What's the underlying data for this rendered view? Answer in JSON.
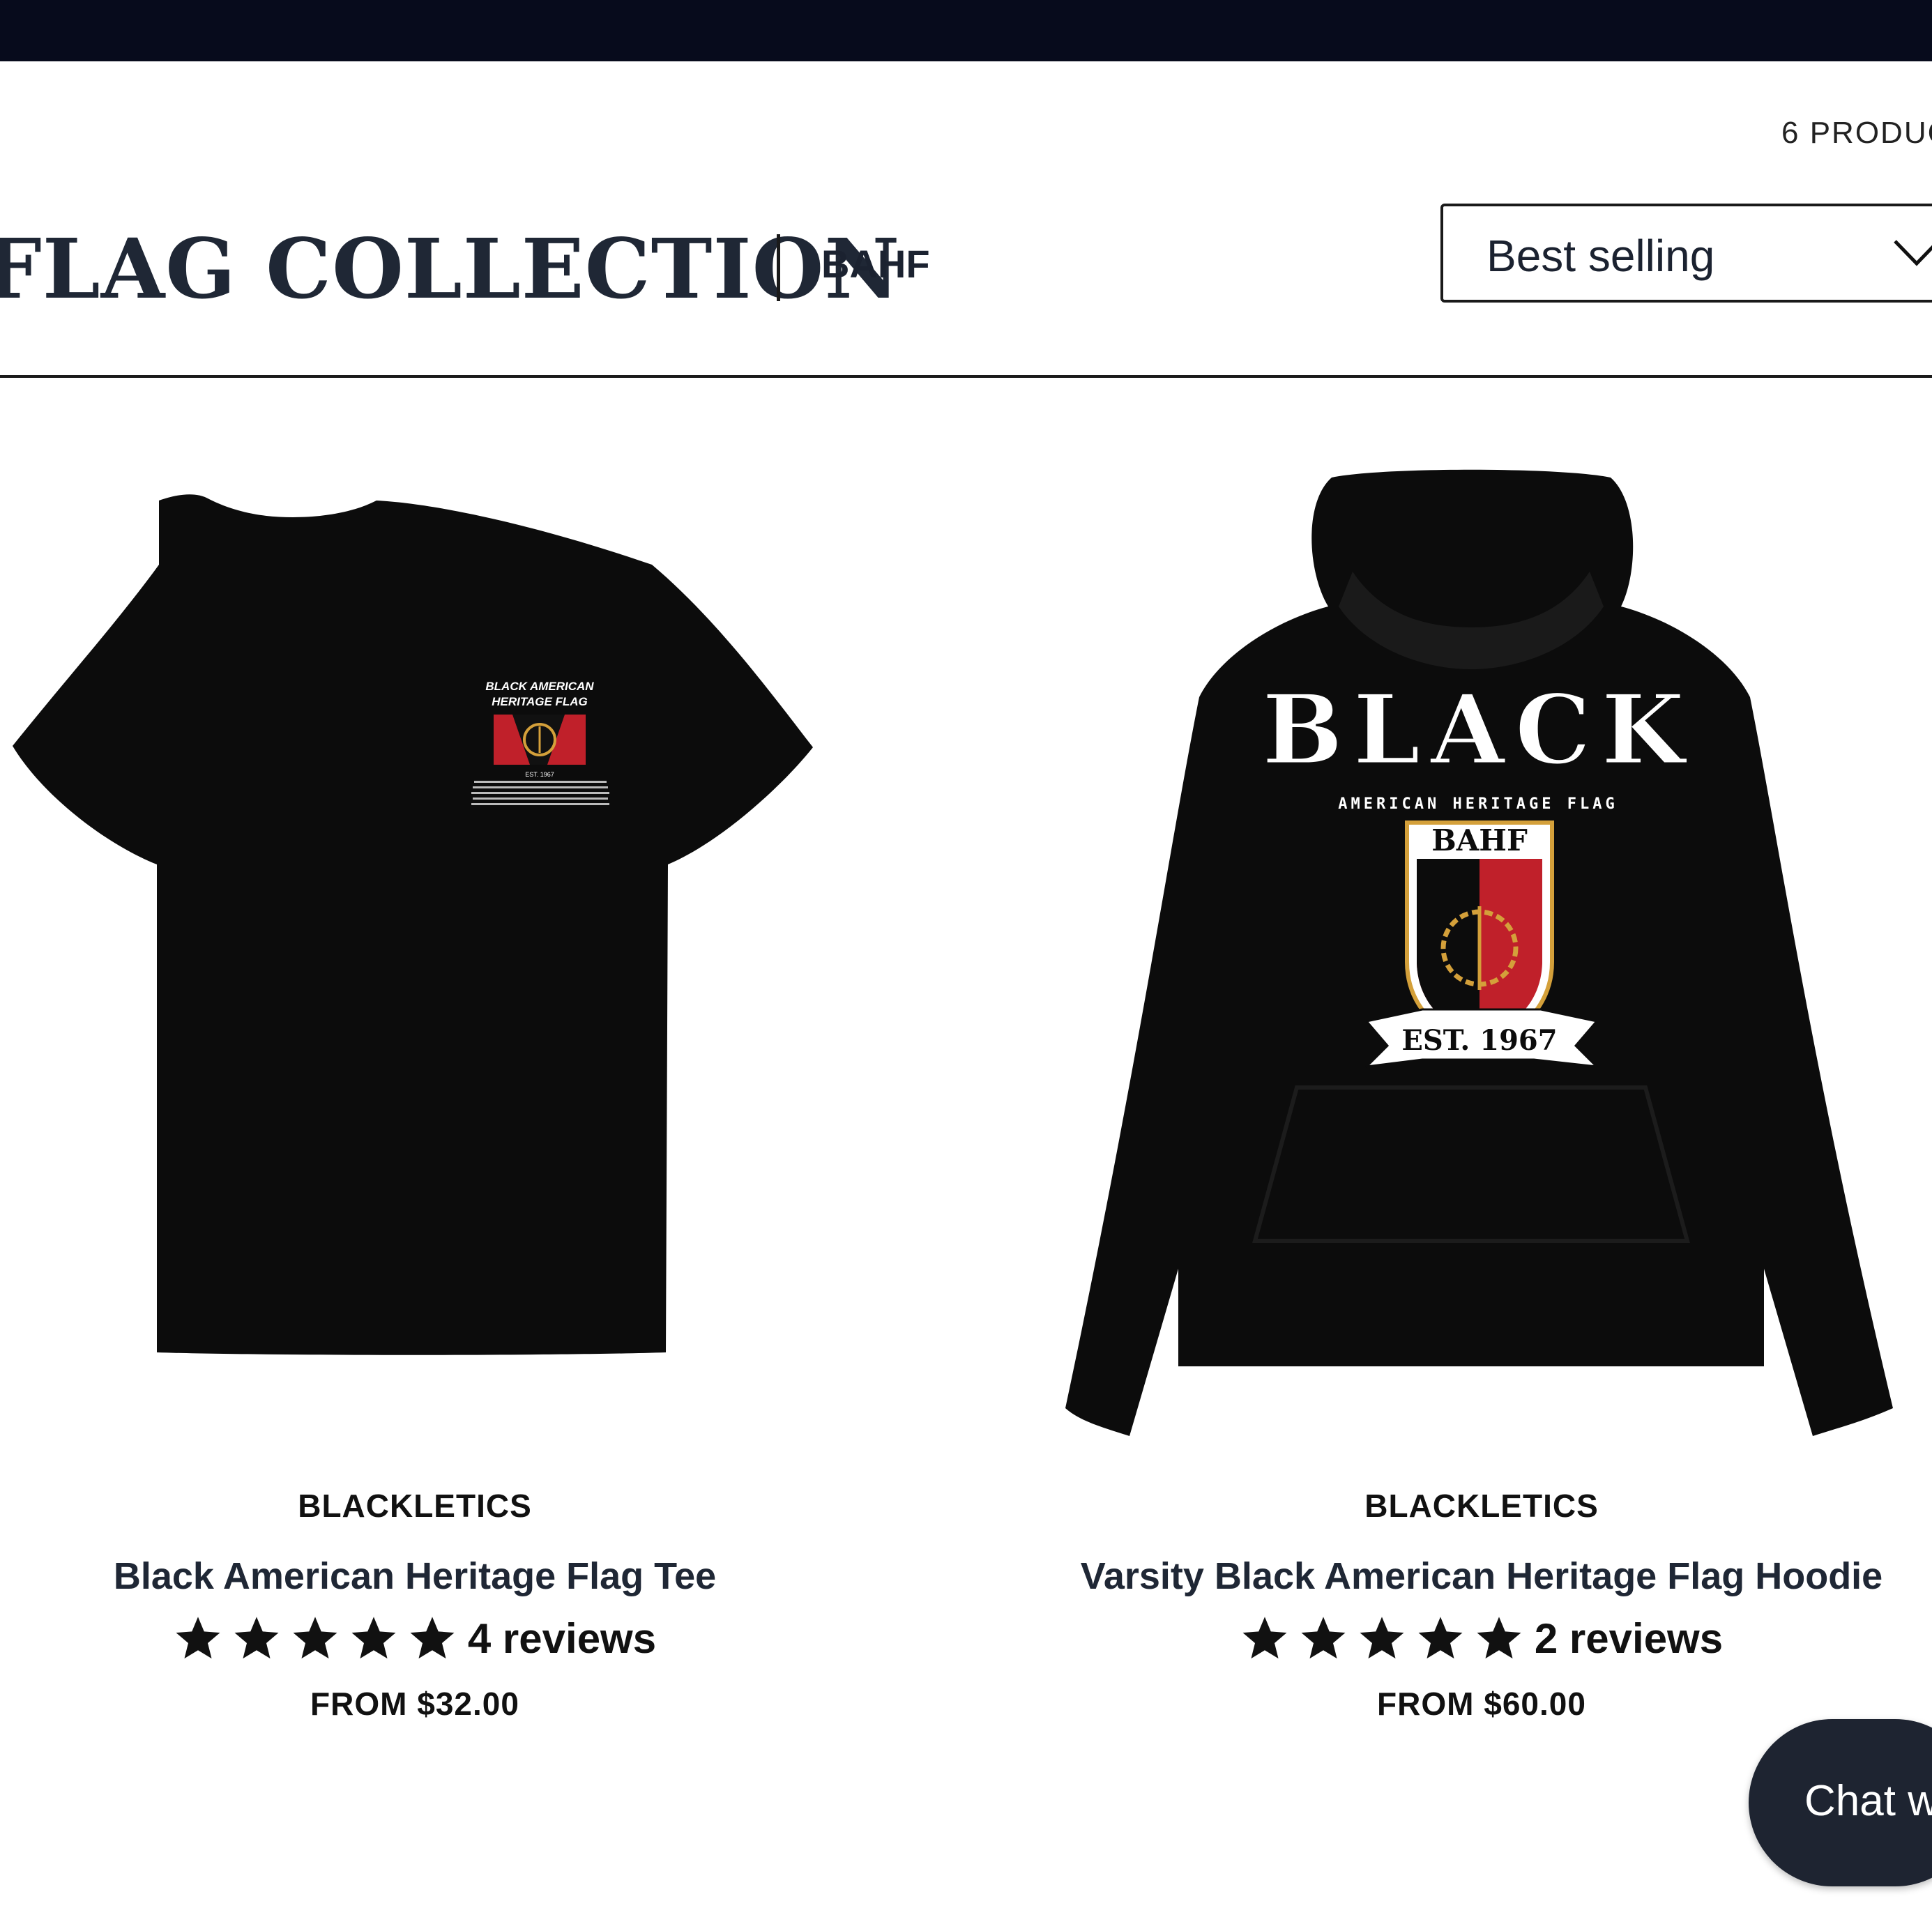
{
  "header": {
    "product_count": "6 PRODUC",
    "collection_title": "FLAG COLLECTION",
    "vendor_tag": "BAHF"
  },
  "sort": {
    "selected": "Best selling",
    "icon": "chevron-down-icon"
  },
  "products": [
    {
      "vendor": "BLACKLETICS",
      "title": "Black American Heritage Flag Tee",
      "rating": 5,
      "reviews": "4 reviews",
      "price": "FROM $32.00",
      "print": {
        "line1": "BLACK AMERICAN",
        "line2": "HERITAGE FLAG",
        "est": "EST. 1967"
      }
    },
    {
      "vendor": "BLACKLETICS",
      "title": "Varsity Black American Heritage Flag Hoodie",
      "rating": 5,
      "reviews": "2 reviews",
      "price": "FROM $60.00",
      "print": {
        "headline": "BLACK",
        "subline": "AMERICAN HERITAGE FLAG",
        "crest": "BAHF",
        "est": "EST. 1967"
      }
    }
  ],
  "chat": {
    "label": "Chat w"
  },
  "colors": {
    "topbar": "#070b1c",
    "flag_red": "#c0202a",
    "gold": "#d4a03a",
    "chat_bg": "#1e2431"
  }
}
